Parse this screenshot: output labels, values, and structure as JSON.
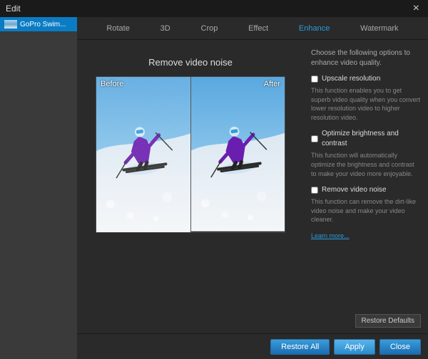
{
  "window": {
    "title": "Edit"
  },
  "sidebar": {
    "items": [
      {
        "label": "GoPro Swim..."
      }
    ]
  },
  "tabs": [
    {
      "label": "Rotate"
    },
    {
      "label": "3D"
    },
    {
      "label": "Crop"
    },
    {
      "label": "Effect"
    },
    {
      "label": "Enhance",
      "active": true
    },
    {
      "label": "Watermark"
    }
  ],
  "preview": {
    "title": "Remove video noise",
    "before_label": "Before",
    "after_label": "After"
  },
  "options": {
    "intro": "Choose the following options to enhance video quality.",
    "items": [
      {
        "label": "Upscale resolution",
        "checked": false,
        "desc": "This function enables you to get superb video quality when you convert lower resolution video to higher resolution video."
      },
      {
        "label": "Optimize brightness and contrast",
        "checked": false,
        "desc": "This function will automatically optimize the brightness and contrast to make your video more enjoyable."
      },
      {
        "label": "Remove video noise",
        "checked": false,
        "desc": "This function can remove the dirt-like video noise and make your video cleaner."
      }
    ],
    "learn_more": "Learn more..."
  },
  "footer": {
    "restore_defaults": "Restore Defaults",
    "restore_all": "Restore All",
    "apply": "Apply",
    "close": "Close"
  }
}
